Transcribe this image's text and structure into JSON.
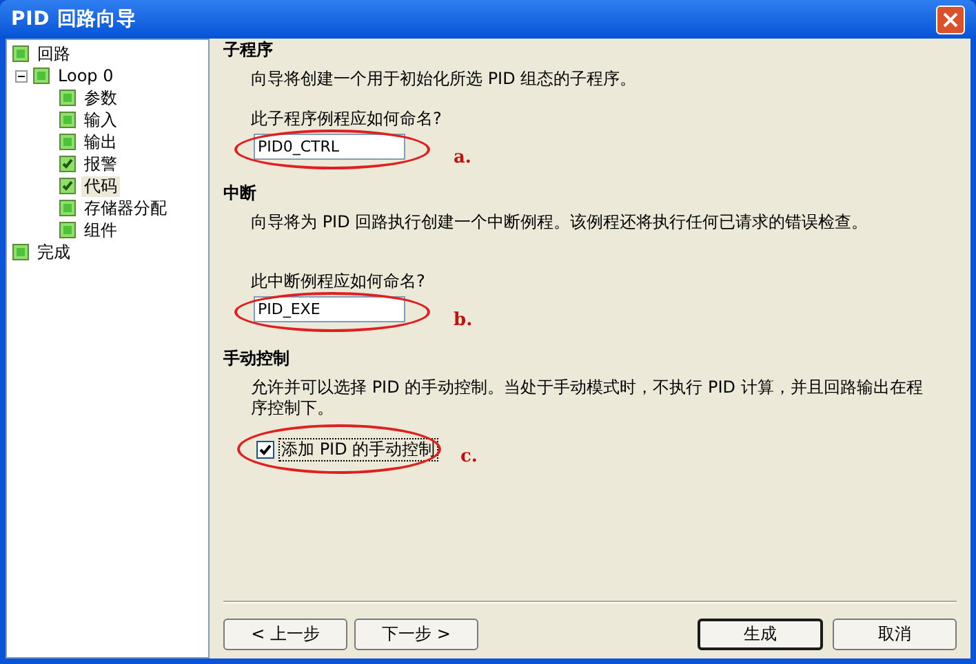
{
  "window": {
    "title": "PID 回路向导"
  },
  "tree": [
    {
      "label": "回路",
      "checked": false,
      "selected": false
    },
    {
      "label": "Loop 0",
      "checked": false,
      "selected": false,
      "expanded": true,
      "children": [
        {
          "label": "参数",
          "checked": false,
          "selected": false
        },
        {
          "label": "输入",
          "checked": false,
          "selected": false
        },
        {
          "label": "输出",
          "checked": false,
          "selected": false
        },
        {
          "label": "报警",
          "checked": true,
          "selected": false
        },
        {
          "label": "代码",
          "checked": true,
          "selected": true
        },
        {
          "label": "存储器分配",
          "checked": false,
          "selected": false
        },
        {
          "label": "组件",
          "checked": false,
          "selected": false
        }
      ]
    },
    {
      "label": "完成",
      "checked": false,
      "selected": false
    }
  ],
  "sections": [
    {
      "kind": "field",
      "heading": "子程序",
      "description": "向导将创建一个用于初始化所选 PID 组态的子程序。",
      "question": "此子程序例程应如何命名?",
      "value": "PID0_CTRL",
      "annotation": "a."
    },
    {
      "kind": "field",
      "heading": "中断",
      "description": "向导将为 PID 回路执行创建一个中断例程。该例程还将执行任何已请求的错误检查。",
      "question": "此中断例程应如何命名?",
      "value": "PID_EXE",
      "annotation": "b."
    },
    {
      "kind": "checkbox",
      "heading": "手动控制",
      "description": "允许并可以选择 PID 的手动控制。当处于手动模式时，不执行 PID 计算，并且回路输出在程序控制下。",
      "option": "添加 PID 的手动控制",
      "checked": true,
      "annotation": "c."
    }
  ],
  "buttons": [
    {
      "label": "< 上一步",
      "default": false
    },
    {
      "label": "下一步 >",
      "default": false
    },
    {
      "label": "生成",
      "default": true
    },
    {
      "label": "取消",
      "default": false
    }
  ]
}
